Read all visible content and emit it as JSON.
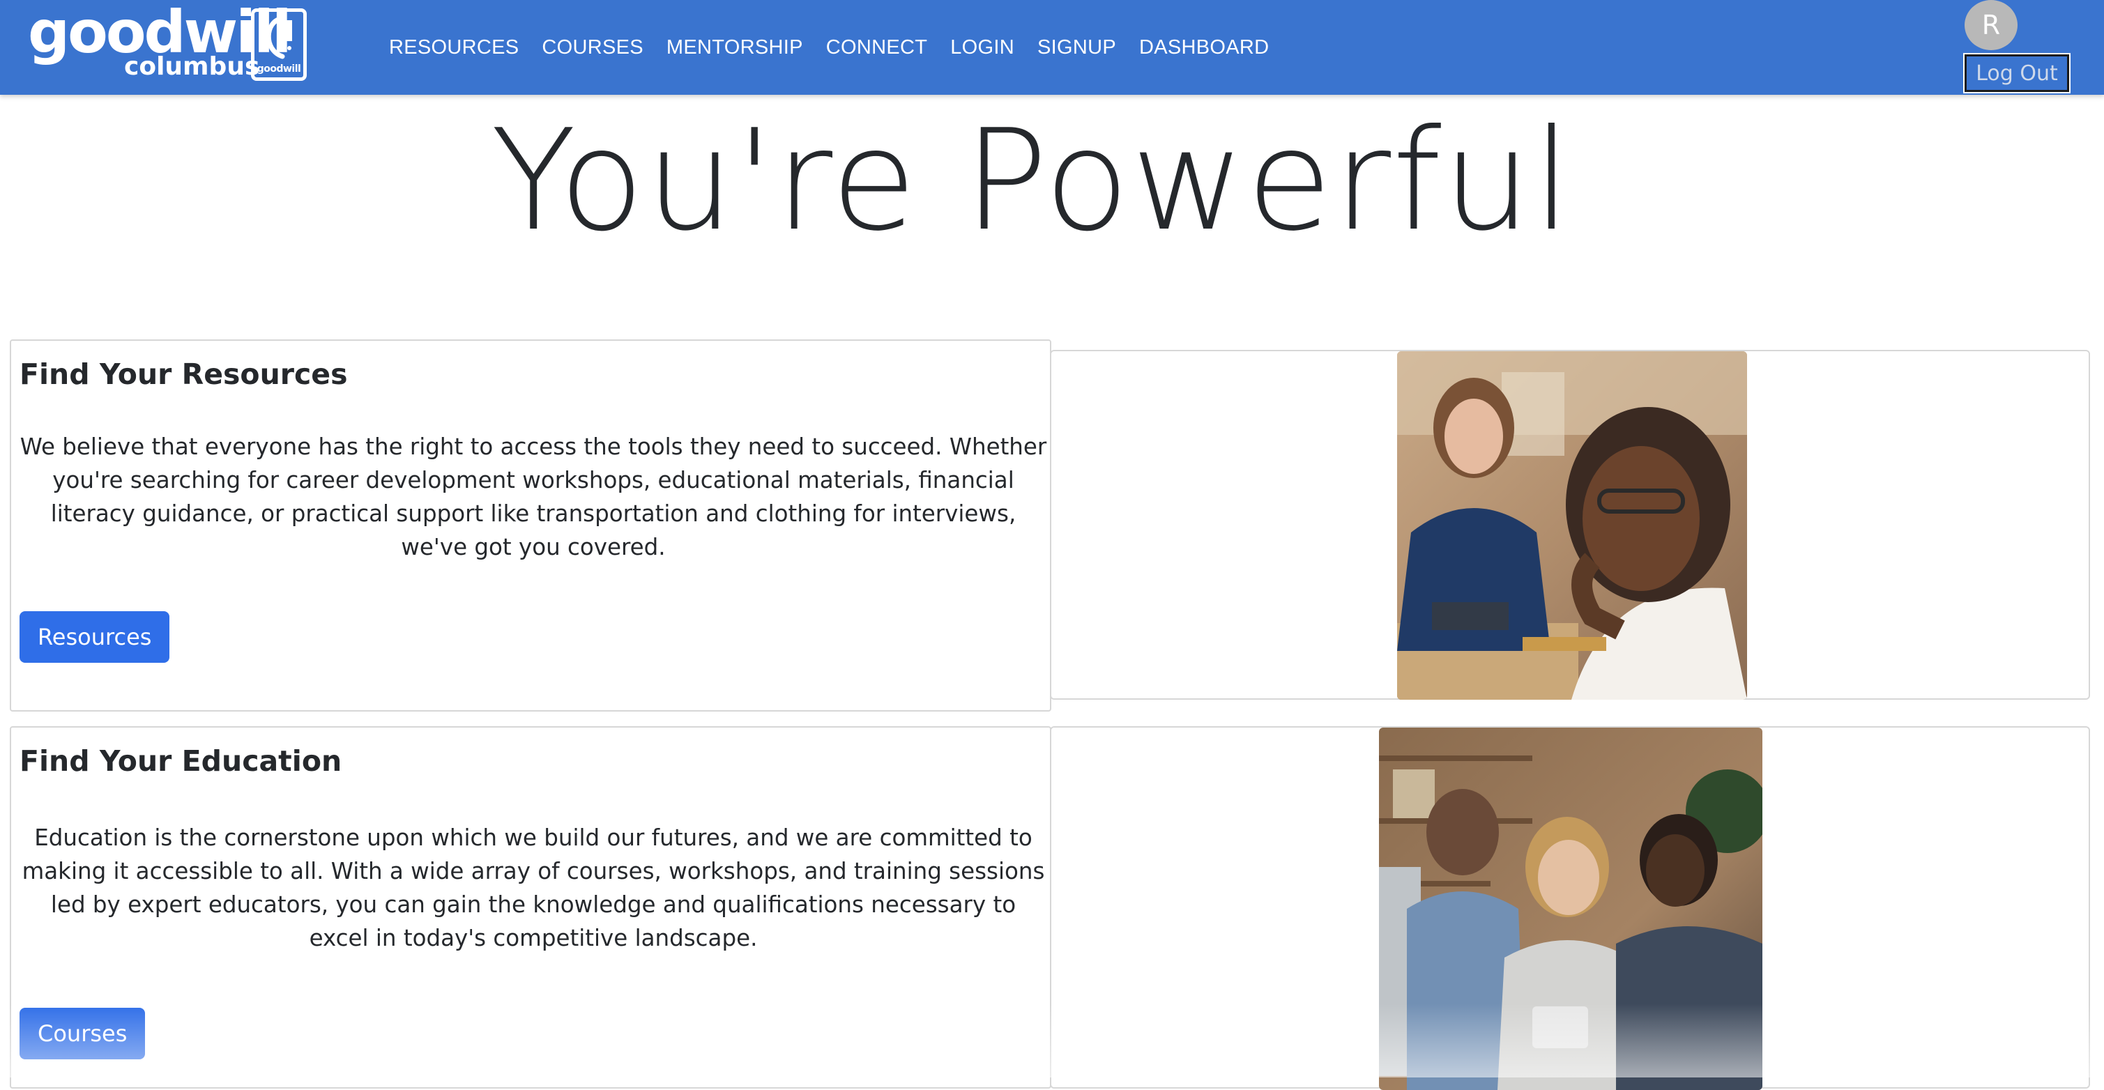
{
  "navbar": {
    "logo": {
      "word": "goodwill",
      "sub": "columbus",
      "mark_text": "goodwill"
    },
    "links": [
      {
        "label": "RESOURCES"
      },
      {
        "label": "COURSES"
      },
      {
        "label": "MENTORSHIP"
      },
      {
        "label": "CONNECT"
      },
      {
        "label": "LOGIN"
      },
      {
        "label": "SIGNUP"
      },
      {
        "label": "DASHBOARD"
      }
    ],
    "avatar_initial": "R",
    "logout_label": "Log Out"
  },
  "hero": {
    "title": "You're Powerful"
  },
  "features": [
    {
      "title": "Find Your Resources",
      "body": "We believe that everyone has the right to access the tools they need to succeed. Whether you're searching for career development workshops, educational materials, financial literacy guidance, or practical support like transportation and clothing for interviews, we've got you covered.",
      "button_label": "Resources"
    },
    {
      "title": "Find Your Education",
      "body": "Education is the cornerstone upon which we build our futures, and we are committed to making it accessible to all. With a wide array of courses, workshops, and training sessions led by expert educators, you can gain the knowledge and qualifications necessary to excel in today's competitive landscape.",
      "button_label": "Courses"
    }
  ],
  "colors": {
    "navbar_bg": "#3a74cf",
    "button_bg": "#2f6ee8",
    "avatar_bg": "#b8b8b8",
    "text": "#25282c"
  }
}
